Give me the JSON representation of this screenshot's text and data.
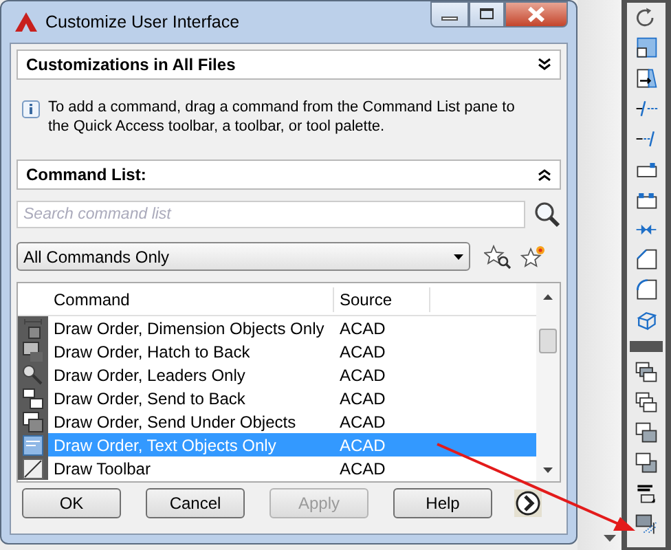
{
  "window": {
    "title": "Customize User Interface"
  },
  "customizations": {
    "title": "Customizations in All Files",
    "expanded": false
  },
  "info": "To add a command, drag a command from the Command List pane to the Quick Access toolbar, a toolbar, or tool palette.",
  "command_list": {
    "title": "Command List:",
    "expanded": true,
    "search": {
      "placeholder": "Search command list"
    },
    "filter": {
      "value": "All Commands Only"
    },
    "table": {
      "columns": [
        "Command",
        "Source"
      ],
      "rows": [
        {
          "command": "Draw Order, Dimension Objects Only",
          "source": "ACAD",
          "selected": false
        },
        {
          "command": "Draw Order, Hatch to Back",
          "source": "ACAD",
          "selected": false
        },
        {
          "command": "Draw Order, Leaders Only",
          "source": "ACAD",
          "selected": false
        },
        {
          "command": "Draw Order, Send to Back",
          "source": "ACAD",
          "selected": false
        },
        {
          "command": "Draw Order, Send Under Objects",
          "source": "ACAD",
          "selected": false
        },
        {
          "command": "Draw Order, Text Objects Only",
          "source": "ACAD",
          "selected": true
        },
        {
          "command": "Draw Toolbar",
          "source": "ACAD",
          "selected": false
        }
      ]
    }
  },
  "buttons": [
    {
      "label": "OK",
      "disabled": false
    },
    {
      "label": "Cancel",
      "disabled": false
    },
    {
      "label": "Apply",
      "disabled": true
    },
    {
      "label": "Help",
      "disabled": false
    }
  ]
}
